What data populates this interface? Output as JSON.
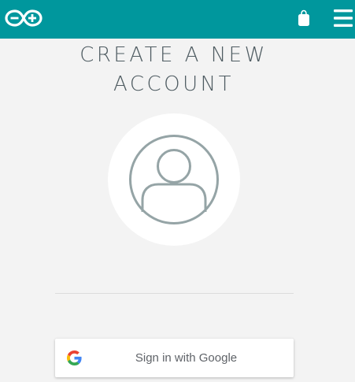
{
  "header": {
    "logo_icon": "arduino-infinity-logo-icon",
    "cart_icon": "shopping-bag-icon",
    "menu_icon": "hamburger-menu-icon",
    "background_color": "#00979d"
  },
  "main": {
    "title_line1": "CREATE A NEW",
    "title_line2": "ACCOUNT",
    "avatar_icon": "user-avatar-icon"
  },
  "google_signin": {
    "label": "Sign in with Google",
    "icon": "google-g-icon"
  }
}
